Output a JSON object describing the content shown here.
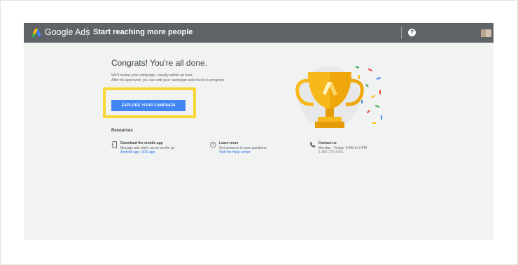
{
  "header": {
    "brand": "Google Ads",
    "title": "Start reaching more people",
    "help_glyph": "?"
  },
  "main": {
    "headline": "Congrats! You're all done.",
    "description_line1": "We'll review your campaign, usually within an hour.",
    "description_line2": "After it's approved, you can edit your campaign and check its progress.",
    "cta_label": "EXPLORE YOUR CAMPAIGN",
    "resources_heading": "Resources"
  },
  "resources": {
    "mobile": {
      "title": "Download the mobile app",
      "subtitle": "Manage ads while you're on the go",
      "link_android": "Android app",
      "link_sep": "|",
      "link_ios": "iOS app"
    },
    "learn": {
      "title": "Learn more",
      "subtitle": "Get answers to your questions",
      "link": "Visit the Help center"
    },
    "contact": {
      "title": "Contact us",
      "subtitle": "Monday - Friday: 9 AM to 9 PM",
      "phone": "1-866-2?6-5451"
    }
  },
  "colors": {
    "topbar": "#5f6368",
    "accent_blue": "#4285f4",
    "highlight": "#f7d736",
    "trophy_gold": "#f6b81a"
  },
  "icons": [
    "google-ads-logo-icon",
    "help-icon",
    "phone-device-icon",
    "question-circle-icon",
    "telephone-icon",
    "trophy-icon"
  ]
}
